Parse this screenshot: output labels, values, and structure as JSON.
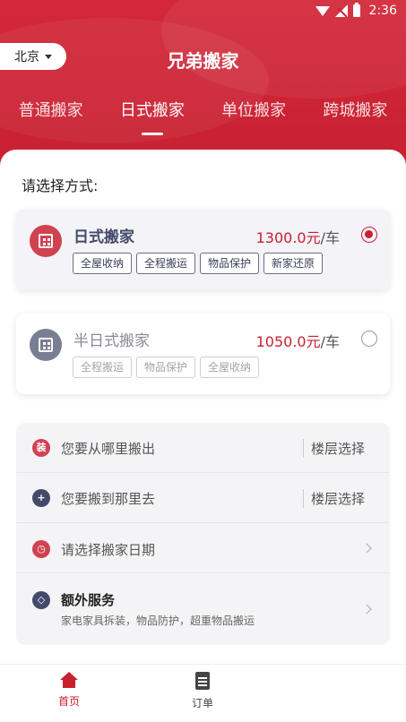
{
  "status_bar": {
    "time": "2:36"
  },
  "header": {
    "city": "北京",
    "title": "兄弟搬家"
  },
  "tabs": [
    {
      "label": "普通搬家",
      "active": false
    },
    {
      "label": "日式搬家",
      "active": true
    },
    {
      "label": "单位搬家",
      "active": false
    },
    {
      "label": "跨城搬家",
      "active": false
    }
  ],
  "choose_label": "请选择方式:",
  "options": [
    {
      "name": "日式搬家",
      "price": "1300.0元",
      "unit": "/车",
      "selected": true,
      "tags": [
        "全屋收纳",
        "全程搬运",
        "物品保护",
        "新家还原"
      ]
    },
    {
      "name": "半日式搬家",
      "price": "1050.0元",
      "unit": "/车",
      "selected": false,
      "tags": [
        "全程搬运",
        "物品保护",
        "全屋收纳"
      ]
    }
  ],
  "form": {
    "from": {
      "icon_text": "装",
      "label": "您要从哪里搬出",
      "floor": "楼层选择"
    },
    "to": {
      "label": "您要搬到那里去",
      "floor": "楼层选择"
    },
    "date": {
      "label": "请选择搬家日期"
    },
    "extra": {
      "label": "额外服务",
      "sub": "家电家具拆装，物品防护，超重物品搬运"
    }
  },
  "bottom_nav": [
    {
      "label": "首页",
      "active": true
    },
    {
      "label": "订单",
      "active": false
    }
  ],
  "colors": {
    "brand": "#c72031",
    "navy": "#434a6a"
  }
}
